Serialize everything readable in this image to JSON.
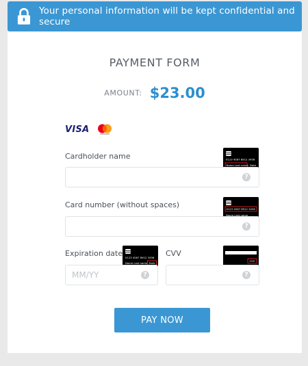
{
  "banner": {
    "icon": "lock-icon",
    "text": "Your personal information will be kept confidential and secure"
  },
  "form": {
    "title": "PAYMENT FORM",
    "amount_label": "AMOUNT:",
    "amount_value": "$23.00"
  },
  "brands": {
    "visa": "VISA",
    "mastercard": "mastercard-logo"
  },
  "fields": {
    "cardholder": {
      "label": "Cardholder name",
      "value": "",
      "placeholder": ""
    },
    "card_number": {
      "label": "Card number (without spaces)",
      "value": "",
      "placeholder": ""
    },
    "expiration": {
      "label": "Expiration date",
      "value": "",
      "placeholder": "MM/YY"
    },
    "cvv": {
      "label": "CVV",
      "value": "",
      "placeholder": ""
    }
  },
  "card_hint": {
    "number": "0123 4567 8912 3456",
    "name": "Name Last name",
    "date": "Date",
    "cvv": "CVV"
  },
  "help_glyph": "?",
  "pay_button": "PAY NOW",
  "colors": {
    "accent": "#3b97d3",
    "amount": "#2a8fcf",
    "hint_highlight": "#e02020"
  }
}
